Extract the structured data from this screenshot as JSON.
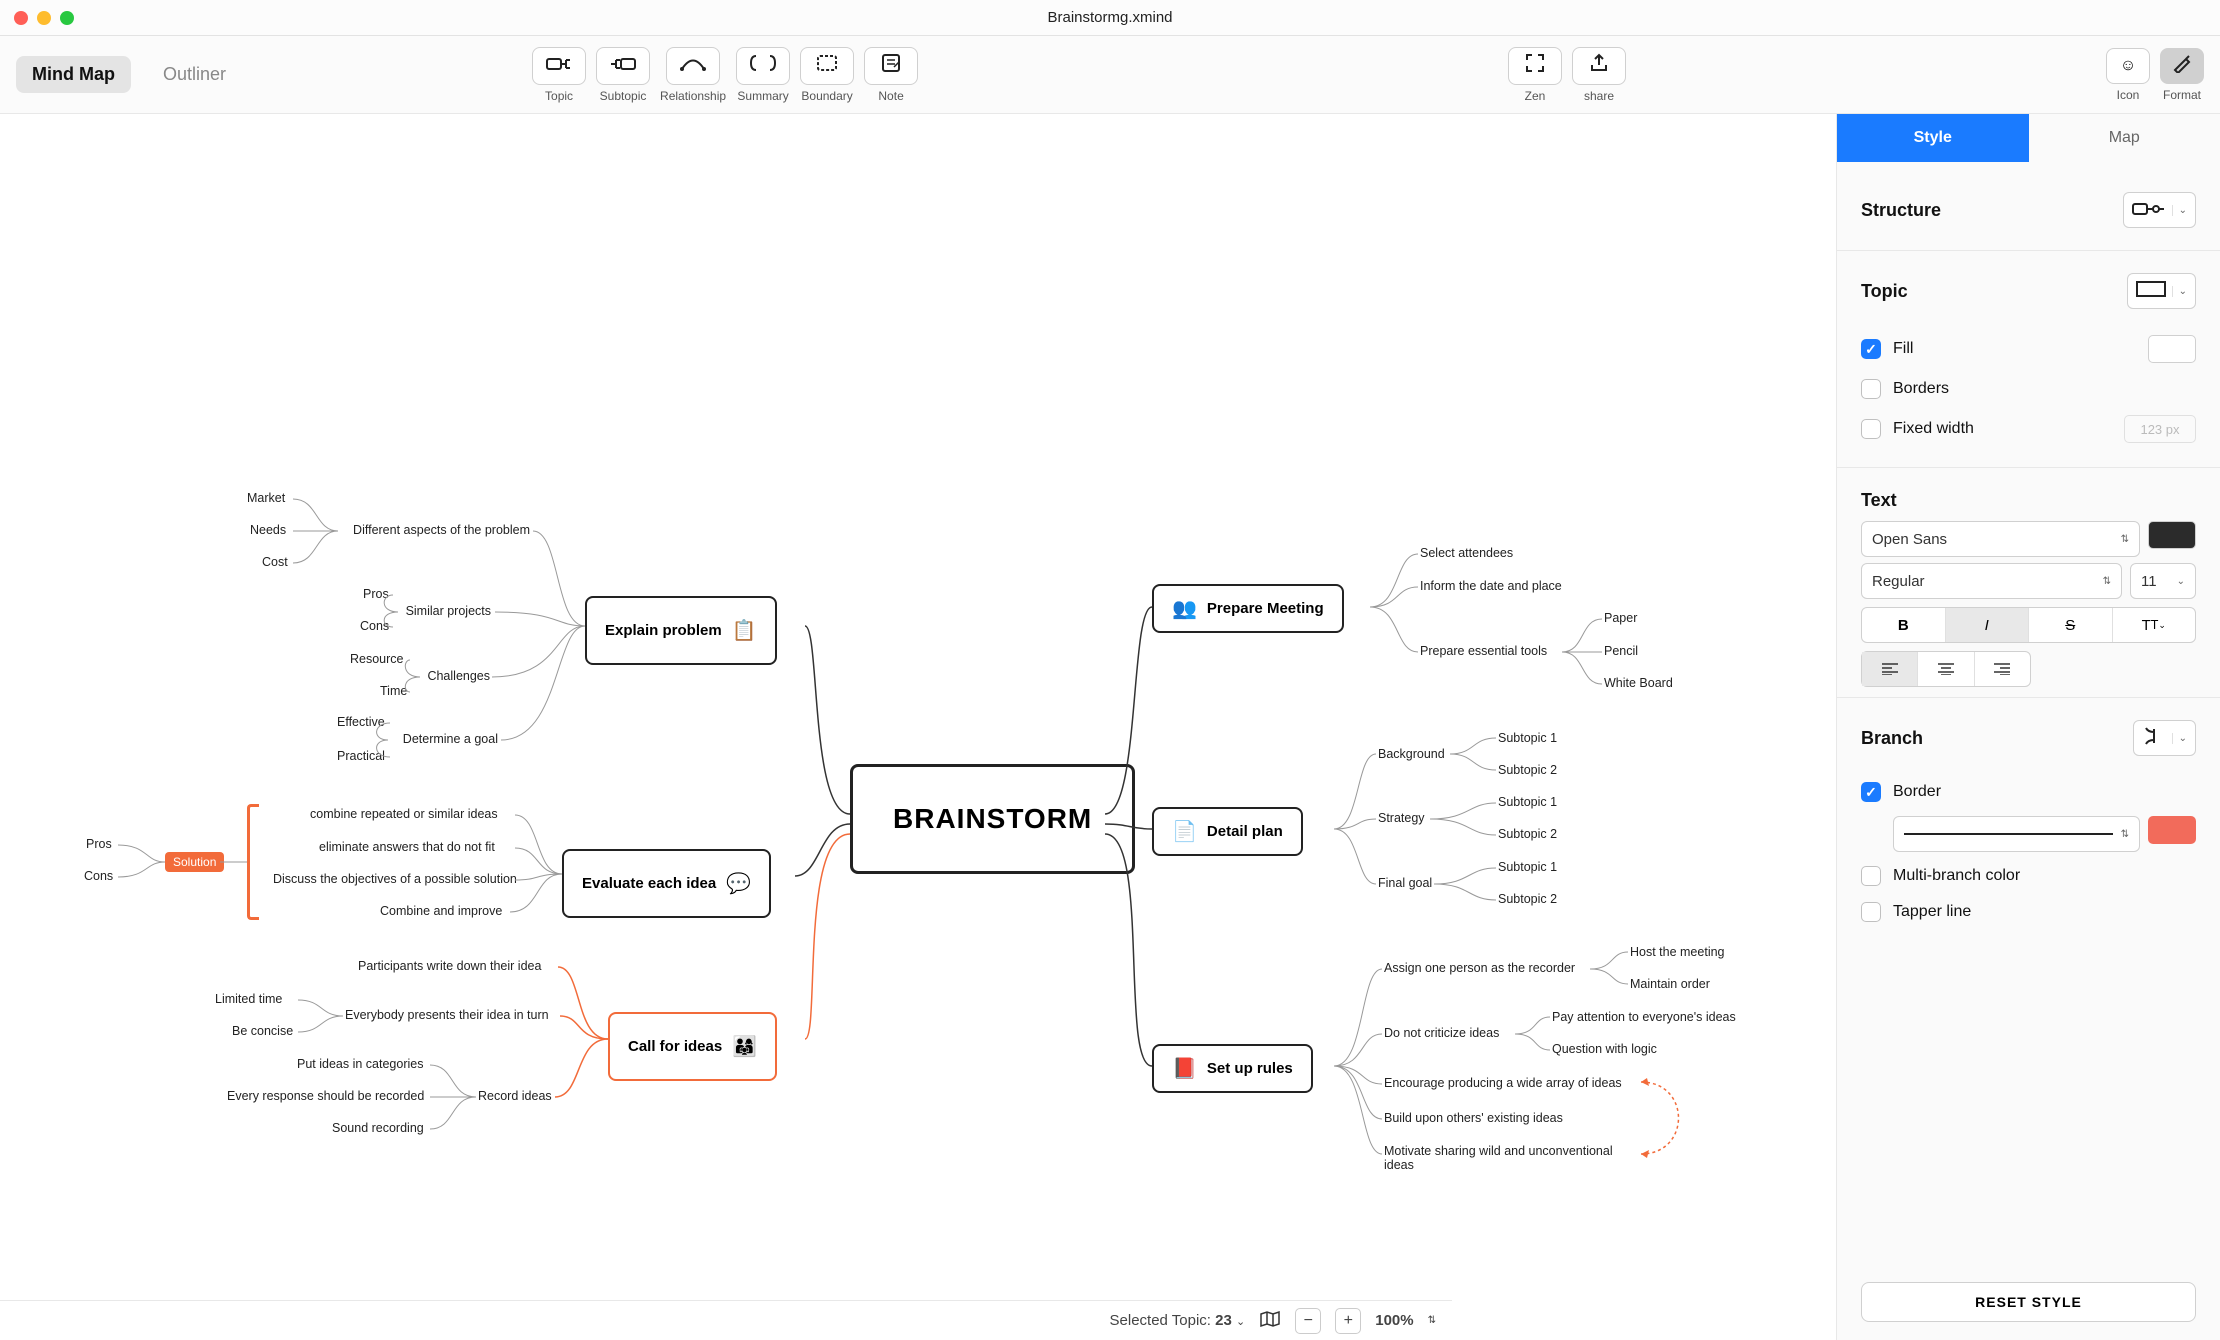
{
  "window_title": "Brainstormg.xmind",
  "view_tabs": {
    "mindmap": "Mind Map",
    "outliner": "Outliner"
  },
  "toolbar": [
    {
      "label": "Topic",
      "icon": "topic"
    },
    {
      "label": "Subtopic",
      "icon": "subtopic"
    },
    {
      "label": "Relationship",
      "icon": "relationship"
    },
    {
      "label": "Summary",
      "icon": "summary"
    },
    {
      "label": "Boundary",
      "icon": "boundary"
    },
    {
      "label": "Note",
      "icon": "note"
    }
  ],
  "toolbar_right": [
    {
      "label": "Zen",
      "icon": "zen"
    },
    {
      "label": "share",
      "icon": "share"
    }
  ],
  "toolbar_far_right": [
    {
      "label": "Icon",
      "icon": "icon"
    },
    {
      "label": "Format",
      "icon": "format",
      "active": true
    }
  ],
  "sidebar": {
    "tabs": {
      "style": "Style",
      "map": "Map"
    },
    "structure_title": "Structure",
    "topic_title": "Topic",
    "fill_label": "Fill",
    "fill_checked": true,
    "borders_label": "Borders",
    "fixed_width_label": "Fixed width",
    "fixed_width_placeholder": "123 px",
    "text_title": "Text",
    "font_family": "Open Sans",
    "font_weight": "Regular",
    "font_size": "11",
    "text_color": "#2b2b2b",
    "branch_title": "Branch",
    "border_label": "Border",
    "border_checked": true,
    "border_color": "#f26b5b",
    "multicolor_label": "Multi-branch color",
    "tapper_label": "Tapper line",
    "reset": "RESET STYLE"
  },
  "status": {
    "selected_prefix": "Selected Topic:",
    "selected_count": "23",
    "zoom": "100%"
  },
  "mindmap": {
    "central": "BRAINSTORM",
    "right_branches": [
      {
        "title": "Prepare Meeting",
        "icon": "👥",
        "children": [
          {
            "t": "Select attendees"
          },
          {
            "t": "Inform the date and place"
          },
          {
            "t": "Prepare essential tools",
            "children": [
              {
                "t": "Paper"
              },
              {
                "t": "Pencil"
              },
              {
                "t": "White Board"
              }
            ]
          }
        ]
      },
      {
        "title": "Detail plan",
        "icon": "📄",
        "children": [
          {
            "t": "Background",
            "children": [
              {
                "t": "Subtopic 1"
              },
              {
                "t": "Subtopic 2"
              }
            ]
          },
          {
            "t": "Strategy",
            "children": [
              {
                "t": "Subtopic 1"
              },
              {
                "t": "Subtopic 2"
              }
            ]
          },
          {
            "t": "Final goal",
            "children": [
              {
                "t": "Subtopic 1"
              },
              {
                "t": "Subtopic 2"
              }
            ]
          }
        ]
      },
      {
        "title": "Set up rules",
        "icon": "📕",
        "children": [
          {
            "t": "Assign one person as the recorder",
            "children": [
              {
                "t": "Host the meeting"
              },
              {
                "t": "Maintain order"
              }
            ]
          },
          {
            "t": "Do not criticize ideas",
            "children": [
              {
                "t": "Pay attention to everyone's ideas"
              },
              {
                "t": "Question with logic"
              }
            ]
          },
          {
            "t": "Encourage producing a wide array of ideas"
          },
          {
            "t": "Build upon others' existing ideas"
          },
          {
            "t": "Motivate sharing wild and unconventional ideas"
          }
        ]
      }
    ],
    "left_branches": [
      {
        "title": "Explain problem",
        "icon": "📋",
        "children": [
          {
            "t": "Different aspects of the problem",
            "children": [
              {
                "t": "Market"
              },
              {
                "t": "Needs"
              },
              {
                "t": "Cost"
              }
            ]
          },
          {
            "t": "Similar projects",
            "children": [
              {
                "t": "Pros"
              },
              {
                "t": "Cons"
              }
            ]
          },
          {
            "t": "Challenges",
            "children": [
              {
                "t": "Resource"
              },
              {
                "t": "Time"
              }
            ]
          },
          {
            "t": "Determine a goal",
            "children": [
              {
                "t": "Effective"
              },
              {
                "t": "Practical"
              }
            ]
          }
        ]
      },
      {
        "title": "Evaluate each idea",
        "icon": "💬",
        "children": [
          {
            "t": "combine repeated or similar ideas"
          },
          {
            "t": "eliminate answers that do not fit"
          },
          {
            "t": "Discuss the objectives of a possible solution"
          },
          {
            "t": "Combine and improve"
          }
        ],
        "summary": {
          "label": "Solution",
          "children": [
            {
              "t": "Pros"
            },
            {
              "t": "Cons"
            }
          ]
        }
      },
      {
        "title": "Call for ideas",
        "icon": "👨‍👩‍👧",
        "orange": true,
        "children": [
          {
            "t": "Participants write down their idea"
          },
          {
            "t": "Everybody presents their idea in turn",
            "children": [
              {
                "t": "Limited time"
              },
              {
                "t": "Be concise"
              }
            ]
          },
          {
            "t": "Record ideas",
            "children": [
              {
                "t": "Put ideas in categories"
              },
              {
                "t": "Every response should be recorded"
              },
              {
                "t": "Sound recording"
              }
            ]
          }
        ]
      }
    ]
  }
}
